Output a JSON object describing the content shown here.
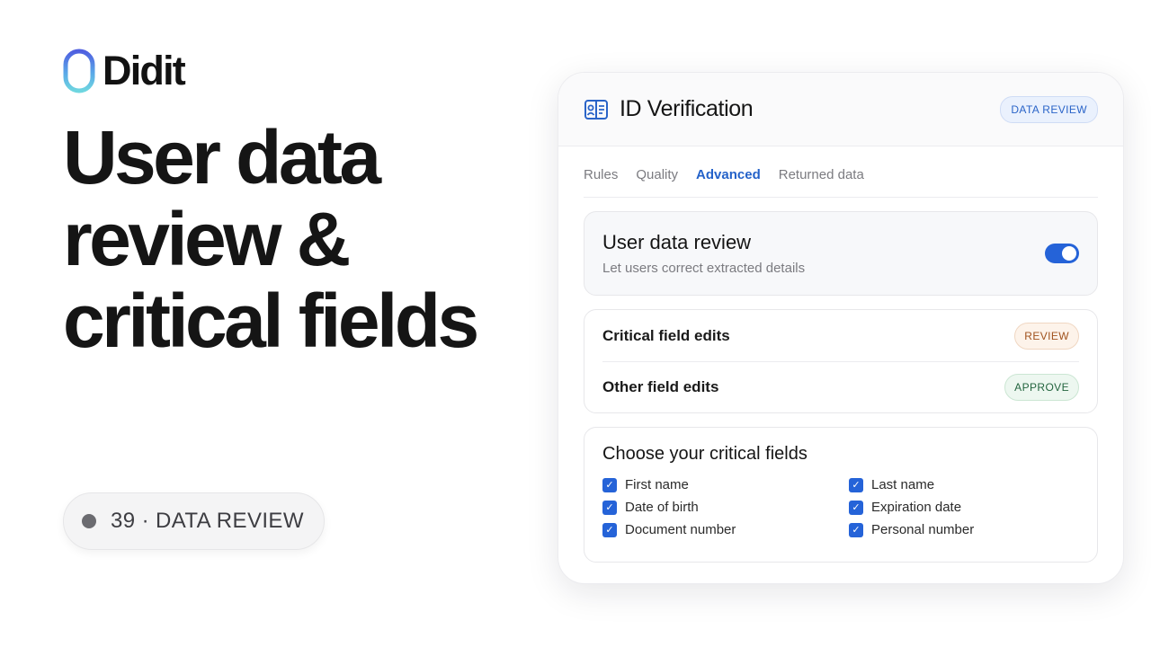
{
  "brand": {
    "name": "Didit",
    "logo_icon": "didit-logo-icon"
  },
  "headline": {
    "lines": [
      "User data",
      "review &",
      "critical fields"
    ]
  },
  "episode": {
    "label": "39 · DATA REVIEW"
  },
  "card": {
    "title": "ID Verification",
    "title_icon": "id-card-icon",
    "badge": "DATA REVIEW",
    "tabs": [
      {
        "label": "Rules",
        "active": false
      },
      {
        "label": "Quality",
        "active": false
      },
      {
        "label": "Advanced",
        "active": true
      },
      {
        "label": "Returned data",
        "active": false
      }
    ],
    "toggle": {
      "title": "User data review",
      "subtitle": "Let users correct extracted details",
      "enabled": true
    },
    "edits": [
      {
        "label": "Critical field edits",
        "action": "REVIEW"
      },
      {
        "label": "Other field edits",
        "action": "APPROVE"
      }
    ],
    "critical_fields": {
      "title": "Choose your critical fields",
      "items": [
        {
          "label": "First name",
          "checked": true
        },
        {
          "label": "Last name",
          "checked": true
        },
        {
          "label": "Date of birth",
          "checked": true
        },
        {
          "label": "Expiration date",
          "checked": true
        },
        {
          "label": "Document number",
          "checked": true
        },
        {
          "label": "Personal number",
          "checked": true
        }
      ]
    }
  },
  "colors": {
    "accent_blue": "#2563d8",
    "tab_active": "#2462c9",
    "review_text": "#a0521e",
    "approve_text": "#24653f"
  }
}
